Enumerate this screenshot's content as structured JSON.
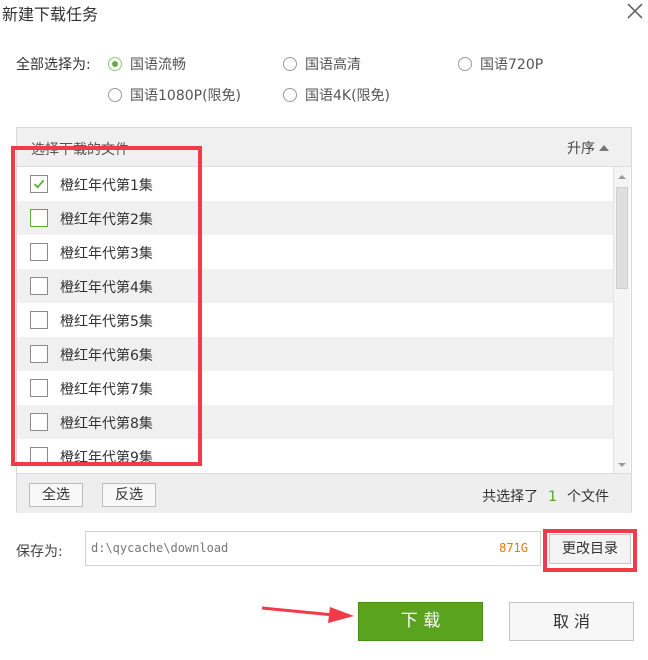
{
  "dialog": {
    "title": "新建下载任务"
  },
  "quality": {
    "label": "全部选择为:",
    "options": [
      {
        "label": "国语流畅",
        "selected": true
      },
      {
        "label": "国语高清",
        "selected": false
      },
      {
        "label": "国语720P",
        "selected": false
      },
      {
        "label": "国语1080P(限免)",
        "selected": false
      },
      {
        "label": "国语4K(限免)",
        "selected": false
      }
    ]
  },
  "files": {
    "header_label": "选择下载的文件",
    "sort_label": "升序",
    "items": [
      {
        "label": "橙红年代第1集",
        "checked": true
      },
      {
        "label": "橙红年代第2集",
        "checked": false
      },
      {
        "label": "橙红年代第3集",
        "checked": false
      },
      {
        "label": "橙红年代第4集",
        "checked": false
      },
      {
        "label": "橙红年代第5集",
        "checked": false
      },
      {
        "label": "橙红年代第6集",
        "checked": false
      },
      {
        "label": "橙红年代第7集",
        "checked": false
      },
      {
        "label": "橙红年代第8集",
        "checked": false
      },
      {
        "label": "橙红年代第9集",
        "checked": false
      }
    ],
    "select_all_label": "全选",
    "invert_label": "反选",
    "selected_prefix": "共选择了",
    "selected_count": "1",
    "selected_suffix": "个文件"
  },
  "save": {
    "label": "保存为:",
    "path": "d:\\qycache\\download",
    "free_space": "871G",
    "change_dir_label": "更改目录"
  },
  "actions": {
    "download_label": "下 载",
    "cancel_label": "取 消"
  },
  "colors": {
    "accent_green": "#5aa31f",
    "highlight_red": "#f23a48",
    "free_space_orange": "#e8790f"
  }
}
